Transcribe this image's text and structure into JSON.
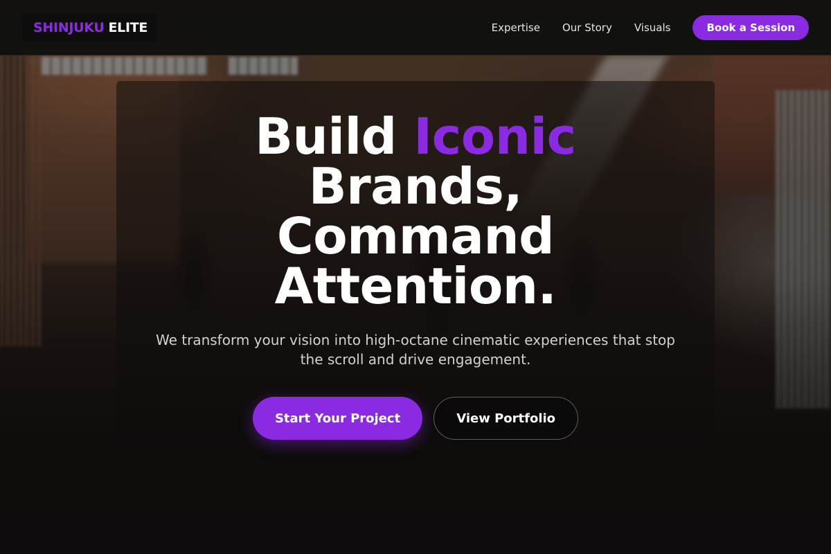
{
  "brand": {
    "logo_accent": "SHINJUKU",
    "logo_plain": "ELITE",
    "accent_color": "#8a2be2"
  },
  "nav": {
    "links": [
      "Expertise",
      "Our Story",
      "Visuals"
    ],
    "cta_label": "Book a Session"
  },
  "hero": {
    "headline_word_1": "Build",
    "headline_highlight": "Iconic",
    "headline_line_2": "Brands,",
    "headline_line_3": "Command",
    "headline_line_4": "Attention.",
    "subtitle": "We transform your vision into high-octane cinematic experiences that stop the scroll and drive engagement.",
    "primary_cta": "Start Your Project",
    "secondary_cta": "View Portfolio"
  }
}
